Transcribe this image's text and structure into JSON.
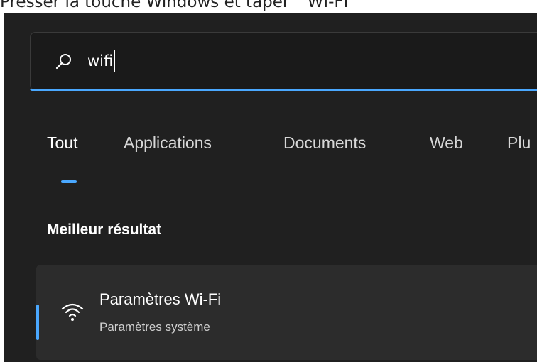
{
  "caption": "Presser la touche Windows et taper \" WI-FI \"",
  "search": {
    "query": "wifi",
    "icon": "search-icon"
  },
  "tabs": [
    {
      "label": "Tout",
      "active": true
    },
    {
      "label": "Applications",
      "active": false
    },
    {
      "label": "Documents",
      "active": false
    },
    {
      "label": "Web",
      "active": false
    },
    {
      "label": "Plu",
      "active": false
    }
  ],
  "best_match": {
    "heading": "Meilleur résultat",
    "title": "Paramètres Wi-Fi",
    "subtitle": "Paramètres système",
    "icon": "wifi-icon"
  },
  "colors": {
    "accent": "#4aa8ff",
    "panel_bg": "#202020",
    "item_bg": "#2c2c2c"
  }
}
